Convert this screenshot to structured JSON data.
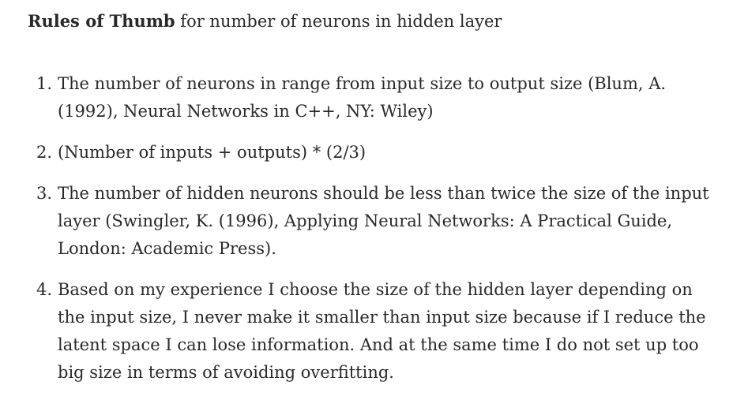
{
  "heading": {
    "bold": "Rules of Thumb",
    "rest": " for number of neurons in hidden layer"
  },
  "rules": [
    {
      "number": "1.",
      "text": "The number of neurons in range from input size to output size (Blum, A. (1992), Neural Networks in C++, NY: Wiley)"
    },
    {
      "number": "2.",
      "text": "(Number of inputs + outputs) * (2/3)"
    },
    {
      "number": "3.",
      "text": "The number of hidden neurons should be less than twice the size of the input layer (Swingler, K. (1996), Applying Neural Networks: A Practical Guide, London: Academic Press)."
    },
    {
      "number": "4.",
      "text": "Based on my experience I choose the size of the hidden layer depending on the input size, I never make it smaller than input size because if I reduce the latent space I can lose information. And at the same time I do not set up too big size in terms of avoiding overfitting."
    }
  ]
}
